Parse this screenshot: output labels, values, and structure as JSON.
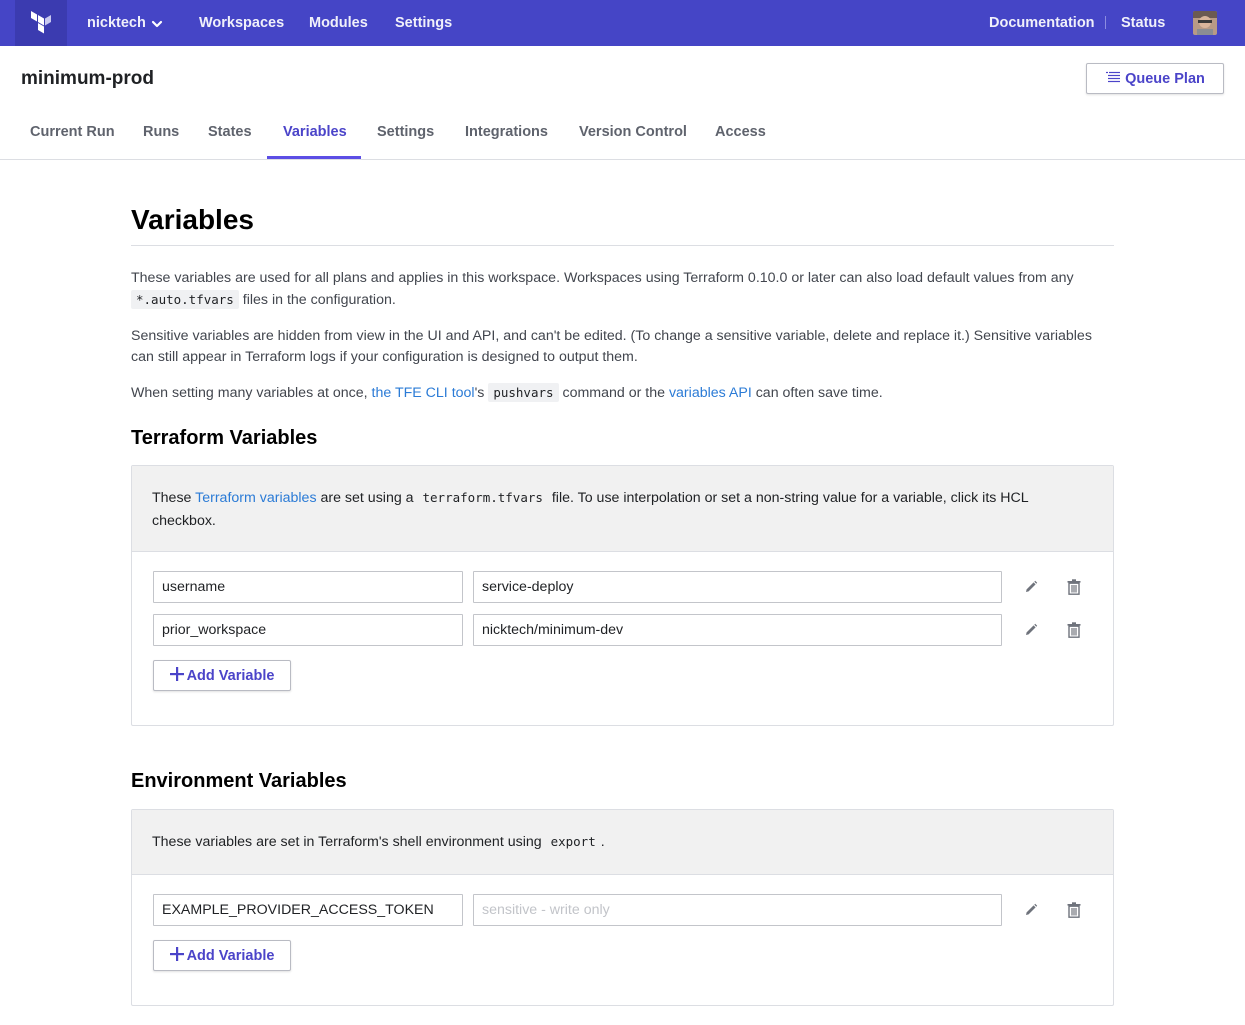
{
  "topnav": {
    "logo": "terraform-logo-icon",
    "org_name": "nicktech",
    "links": [
      "Workspaces",
      "Modules",
      "Settings"
    ],
    "right_links": [
      "Documentation",
      "Status"
    ]
  },
  "workspace": {
    "name": "minimum-prod",
    "queue_plan_label": "Queue Plan"
  },
  "tabs": [
    "Current Run",
    "Runs",
    "States",
    "Variables",
    "Settings",
    "Integrations",
    "Version Control",
    "Access"
  ],
  "active_tab": "Variables",
  "page": {
    "heading": "Variables",
    "intro1_text": "These variables are used for all plans and applies in this workspace. Workspaces using Terraform 0.10.0 or later can also load default values from any",
    "intro1_code": "*.auto.tfvars",
    "intro1_tail": " files in the configuration.",
    "intro2": "Sensitive variables are hidden from view in the UI and API, and can't be edited. (To change a sensitive variable, delete and replace it.) Sensitive variables can still appear in Terraform logs if your configuration is designed to output them.",
    "intro3_pre": "When setting many variables at once, ",
    "intro3_link1": "the TFE CLI tool",
    "intro3_mid1": "'s ",
    "intro3_code": "pushvars",
    "intro3_mid2": " command or the ",
    "intro3_link2": "variables API",
    "intro3_tail": " can often save time."
  },
  "terraform_vars": {
    "title": "Terraform Variables",
    "note_pre": "These ",
    "note_link": "Terraform variables",
    "note_mid": " are set using a ",
    "note_code": "terraform.tfvars",
    "note_tail": " file. To use interpolation or set a non-string value for a variable, click its HCL checkbox.",
    "rows": [
      {
        "key": "username",
        "value": "service-deploy"
      },
      {
        "key": "prior_workspace",
        "value": "nicktech/minimum-dev"
      }
    ],
    "add_label": "Add Variable"
  },
  "env_vars": {
    "title": "Environment Variables",
    "note_pre": "These variables are set in Terraform's shell environment using ",
    "note_code": "export",
    "note_tail": ".",
    "rows": [
      {
        "key": "EXAMPLE_PROVIDER_ACCESS_TOKEN",
        "value": "",
        "placeholder": "sensitive - write only"
      }
    ],
    "add_label": "Add Variable"
  },
  "colors": {
    "nav_bg": "#4545c6",
    "accent": "#4b44c9",
    "link": "#2b7bd6"
  }
}
